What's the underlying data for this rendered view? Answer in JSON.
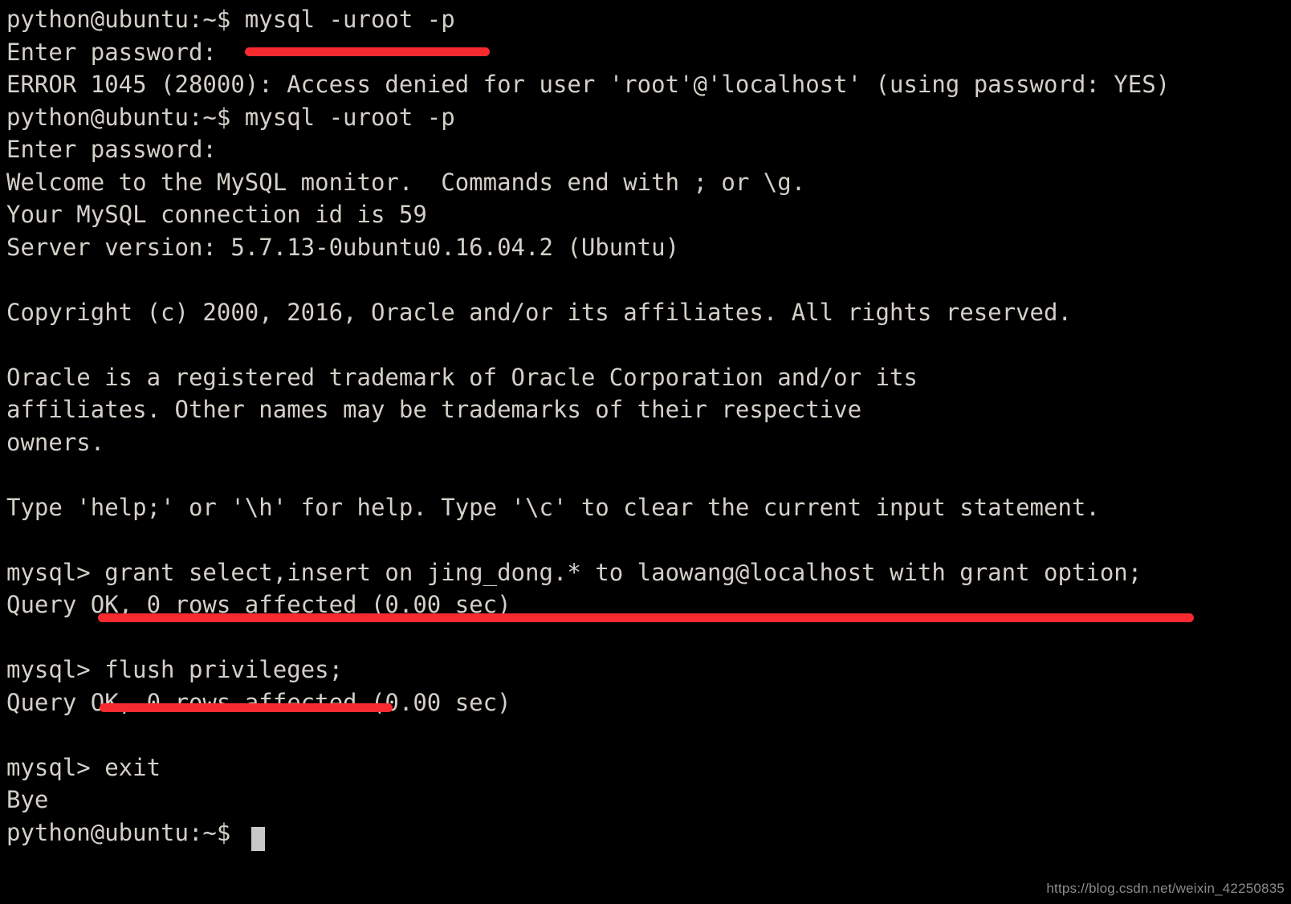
{
  "terminal": {
    "title": "python@ubuntu terminal",
    "background_color": "#000000",
    "foreground_color": "#d4d0c8",
    "annotation_color": "#f72a30",
    "cursor_color": "#c8c8c8",
    "prompt_user_host": "python@ubuntu:~$",
    "mysql_prompt": "mysql>",
    "lines": [
      "python@ubuntu:~$ mysql -uroot -p",
      "Enter password:",
      "ERROR 1045 (28000): Access denied for user 'root'@'localhost' (using password: YES)",
      "python@ubuntu:~$ mysql -uroot -p",
      "Enter password:",
      "Welcome to the MySQL monitor.  Commands end with ; or \\g.",
      "Your MySQL connection id is 59",
      "Server version: 5.7.13-0ubuntu0.16.04.2 (Ubuntu)",
      "",
      "Copyright (c) 2000, 2016, Oracle and/or its affiliates. All rights reserved.",
      "",
      "Oracle is a registered trademark of Oracle Corporation and/or its",
      "affiliates. Other names may be trademarks of their respective",
      "owners.",
      "",
      "Type 'help;' or '\\h' for help. Type '\\c' to clear the current input statement.",
      "",
      "mysql> grant select,insert on jing_dong.* to laowang@localhost with grant option;",
      "Query OK, 0 rows affected (0.00 sec)",
      "",
      "mysql> flush privileges;",
      "Query OK, 0 rows affected (0.00 sec)",
      "",
      "mysql> exit",
      "Bye",
      "python@ubuntu:~$ "
    ],
    "annotations": [
      {
        "name": "password-redaction-bar",
        "covers": "hidden password entry after 'Enter password:'"
      },
      {
        "name": "grant-statement-underline",
        "covers": "underline beneath the grant select,insert statement"
      },
      {
        "name": "flush-privileges-underline",
        "covers": "underline beneath the flush privileges statement"
      }
    ]
  },
  "watermark": {
    "text": "https://blog.csdn.net/weixin_42250835"
  }
}
